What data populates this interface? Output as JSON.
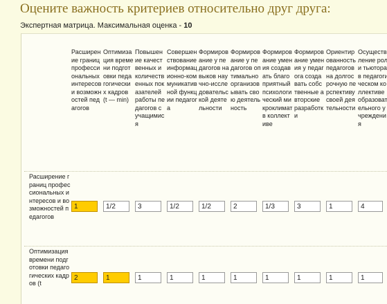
{
  "page": {
    "title": "Оцените важность критериев относительно друг друга:",
    "subtitle_prefix": "Экспертная матрица. Максимальная оценка - ",
    "max_score": "10"
  },
  "columns": [
    "Расширение границ профессиональных интересов и возможностей педагогов",
    "Оптимизация времени подготовки педагогических кадров (t — min)",
    "Повышение качественных и количественных показателей работы педагогов с учащимися",
    "Совершенствование информационно-коммуникативной функции педагога",
    "Формирование у педагогов навыков научно-исследовательской деятельности",
    "Формирование у педагогов оптимально организовывать свою деятельность",
    "Формирование умения создавать благоприятный психологический микроклимат в коллективе",
    "Формирование умения у педагога создавать собственные авторские разработки",
    "Ориентированность педагогов на долгосрочную перспективу своей деятельности",
    "Осуществление роли тьютора в педагогическом коллективе образовательного учреждения"
  ],
  "rows": [
    {
      "label": "Расширение границ профессиональных интересов и возможностей педагогов",
      "values": [
        "1",
        "1/2",
        "3",
        "1/2",
        "1/2",
        "2",
        "1/3",
        "3",
        "1",
        "4"
      ]
    },
    {
      "label": "Оптимизация времени подготовки педагогических кадров (t",
      "values": [
        "2",
        "1",
        "1",
        "1",
        "1",
        "1",
        "1",
        "1",
        "1",
        "1"
      ]
    }
  ],
  "highlight_color": "#ffcc00",
  "title_color": "#8a7020"
}
